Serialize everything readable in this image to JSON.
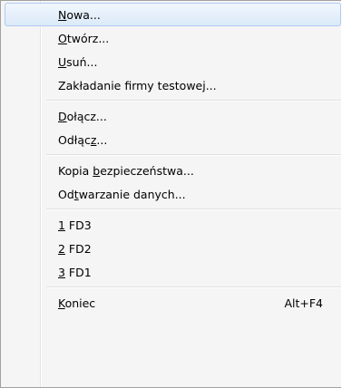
{
  "menu": {
    "items": [
      {
        "pre": "",
        "acc": "N",
        "post": "owa...",
        "shortcut": ""
      },
      {
        "pre": "",
        "acc": "O",
        "post": "twórz...",
        "shortcut": ""
      },
      {
        "pre": "",
        "acc": "U",
        "post": "suń...",
        "shortcut": ""
      },
      {
        "pre": "",
        "acc": "",
        "post": "Zakładanie firmy testowej...",
        "shortcut": ""
      },
      {
        "pre": "",
        "acc": "D",
        "post": "ołącz...",
        "shortcut": ""
      },
      {
        "pre": "Odłąc",
        "acc": "z",
        "post": "...",
        "shortcut": ""
      },
      {
        "pre": "Kopia ",
        "acc": "b",
        "post": "ezpieczeństwa...",
        "shortcut": ""
      },
      {
        "pre": "Od",
        "acc": "t",
        "post": "warzanie danych...",
        "shortcut": ""
      },
      {
        "pre": "",
        "acc": "1",
        "post": " FD3",
        "shortcut": ""
      },
      {
        "pre": "",
        "acc": "2",
        "post": " FD2",
        "shortcut": ""
      },
      {
        "pre": "",
        "acc": "3",
        "post": " FD1",
        "shortcut": ""
      },
      {
        "pre": "",
        "acc": "K",
        "post": "oniec",
        "shortcut": "Alt+F4"
      }
    ]
  },
  "colors": {
    "menu_background": "#f5f5f5",
    "hover_border": "#aecaf0",
    "hover_fill": "#dbe9f8"
  }
}
